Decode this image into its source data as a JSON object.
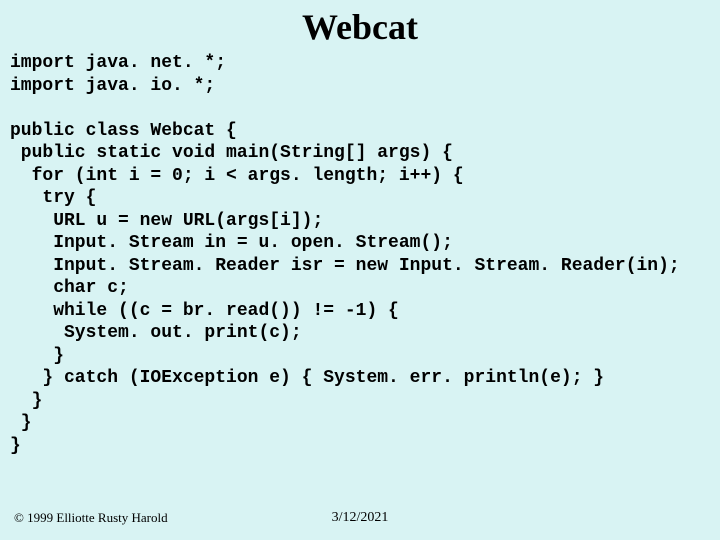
{
  "title": "Webcat",
  "code": "import java. net. *;\nimport java. io. *;\n\npublic class Webcat {\n public static void main(String[] args) {\n  for (int i = 0; i < args. length; i++) {\n   try {\n    URL u = new URL(args[i]);\n    Input. Stream in = u. open. Stream();\n    Input. Stream. Reader isr = new Input. Stream. Reader(in);\n    char c;\n    while ((c = br. read()) != -1) {\n     System. out. print(c);\n    }\n   } catch (IOException e) { System. err. println(e); }\n  }\n }\n}",
  "footer": {
    "copyright": "© 1999 Elliotte Rusty Harold",
    "date": "3/12/2021"
  }
}
